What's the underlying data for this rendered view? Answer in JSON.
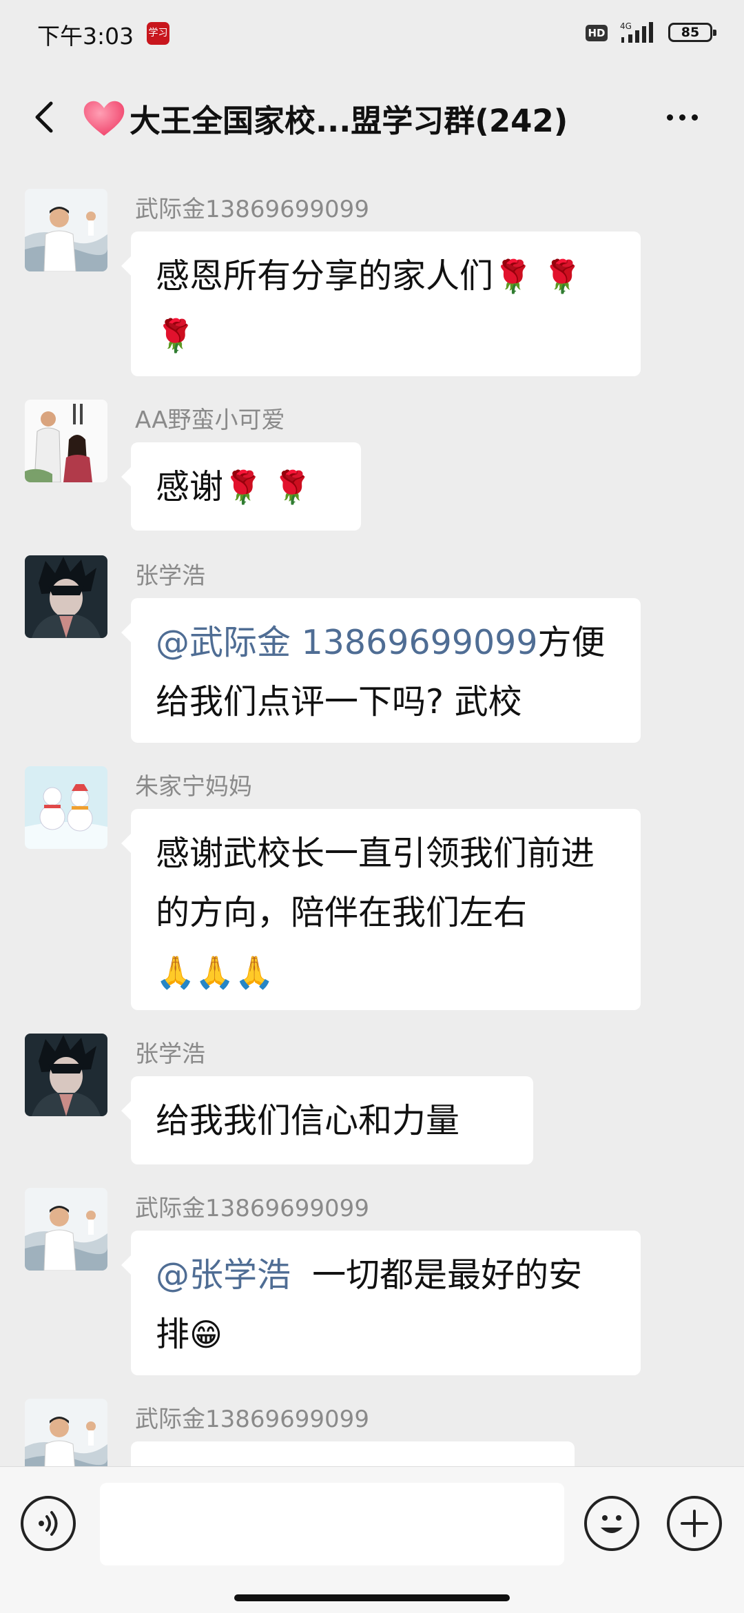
{
  "status_bar": {
    "time": "下午3:03",
    "app_badge": "学习",
    "hd": "HD",
    "network": "4G",
    "battery": "85"
  },
  "header": {
    "title": "大王全国家校...盟学习群(242)",
    "icons": [
      "back-arrow-icon",
      "heart-icon",
      "more-dots-icon"
    ]
  },
  "messages": [
    {
      "sender": "武际金13869699099",
      "text": "感恩所有分享的家人们",
      "emoji": "🌹 🌹 🌹",
      "avatar": "man-in-white-suit"
    },
    {
      "sender": "AA野蛮小可爱",
      "text": "感谢",
      "emoji": "🌹 🌹",
      "avatar": "couple-painting"
    },
    {
      "sender": "张学浩",
      "mention": "@武际金 13869699099",
      "text": "方便给我们点评一下吗? 武校",
      "avatar": "anime-boy"
    },
    {
      "sender": "朱家宁妈妈",
      "text": "感谢武校长一直引领我们前进的方向，陪伴在我们左右",
      "emoji": "🙏🙏🙏",
      "avatar": "snowmen"
    },
    {
      "sender": "张学浩",
      "text": "给我我们信心和力量",
      "avatar": "anime-boy"
    },
    {
      "sender": "武际金13869699099",
      "mention": "@张学浩",
      "text": "一切都是最好的安排",
      "emoji": "😁",
      "avatar": "man-in-white-suit"
    },
    {
      "sender": "武际金13869699099",
      "text": "",
      "avatar": "man-in-white-suit"
    }
  ],
  "input_bar": {
    "placeholder": "",
    "icons": [
      "voice-icon",
      "emoji-icon",
      "plus-icon"
    ]
  },
  "colors": {
    "background": "#ededed",
    "bubble": "#ffffff",
    "mention": "#4f6d94",
    "sender": "#8a8a8a"
  }
}
